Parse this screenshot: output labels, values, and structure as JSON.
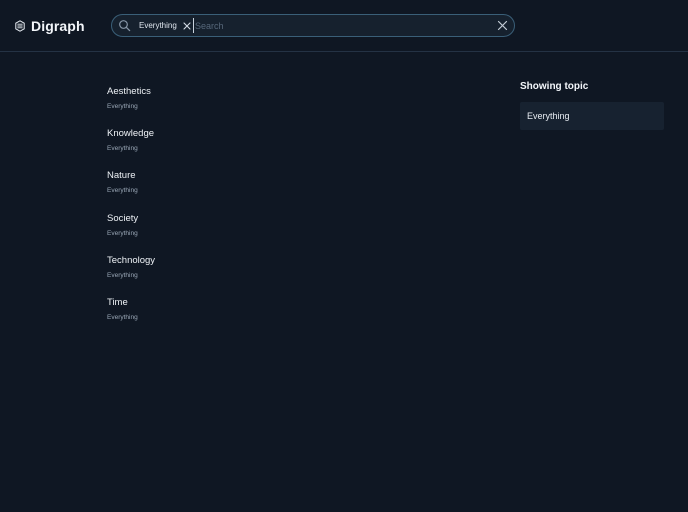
{
  "brand": {
    "name": "Digraph",
    "icon": "hexagon-nodes-icon"
  },
  "search": {
    "placeholder": "Search",
    "value": "",
    "selected_topic": "Everything"
  },
  "topics": [
    {
      "name": "Aesthetics",
      "parent": "Everything"
    },
    {
      "name": "Knowledge",
      "parent": "Everything"
    },
    {
      "name": "Nature",
      "parent": "Everything"
    },
    {
      "name": "Society",
      "parent": "Everything"
    },
    {
      "name": "Technology",
      "parent": "Everything"
    },
    {
      "name": "Time",
      "parent": "Everything"
    }
  ],
  "sidebar": {
    "title": "Showing topic",
    "topic": "Everything"
  },
  "colors": {
    "background": "#0f1723",
    "search_border": "#3a5f78",
    "card": "#172230",
    "muted_text": "#9aa7b6"
  }
}
